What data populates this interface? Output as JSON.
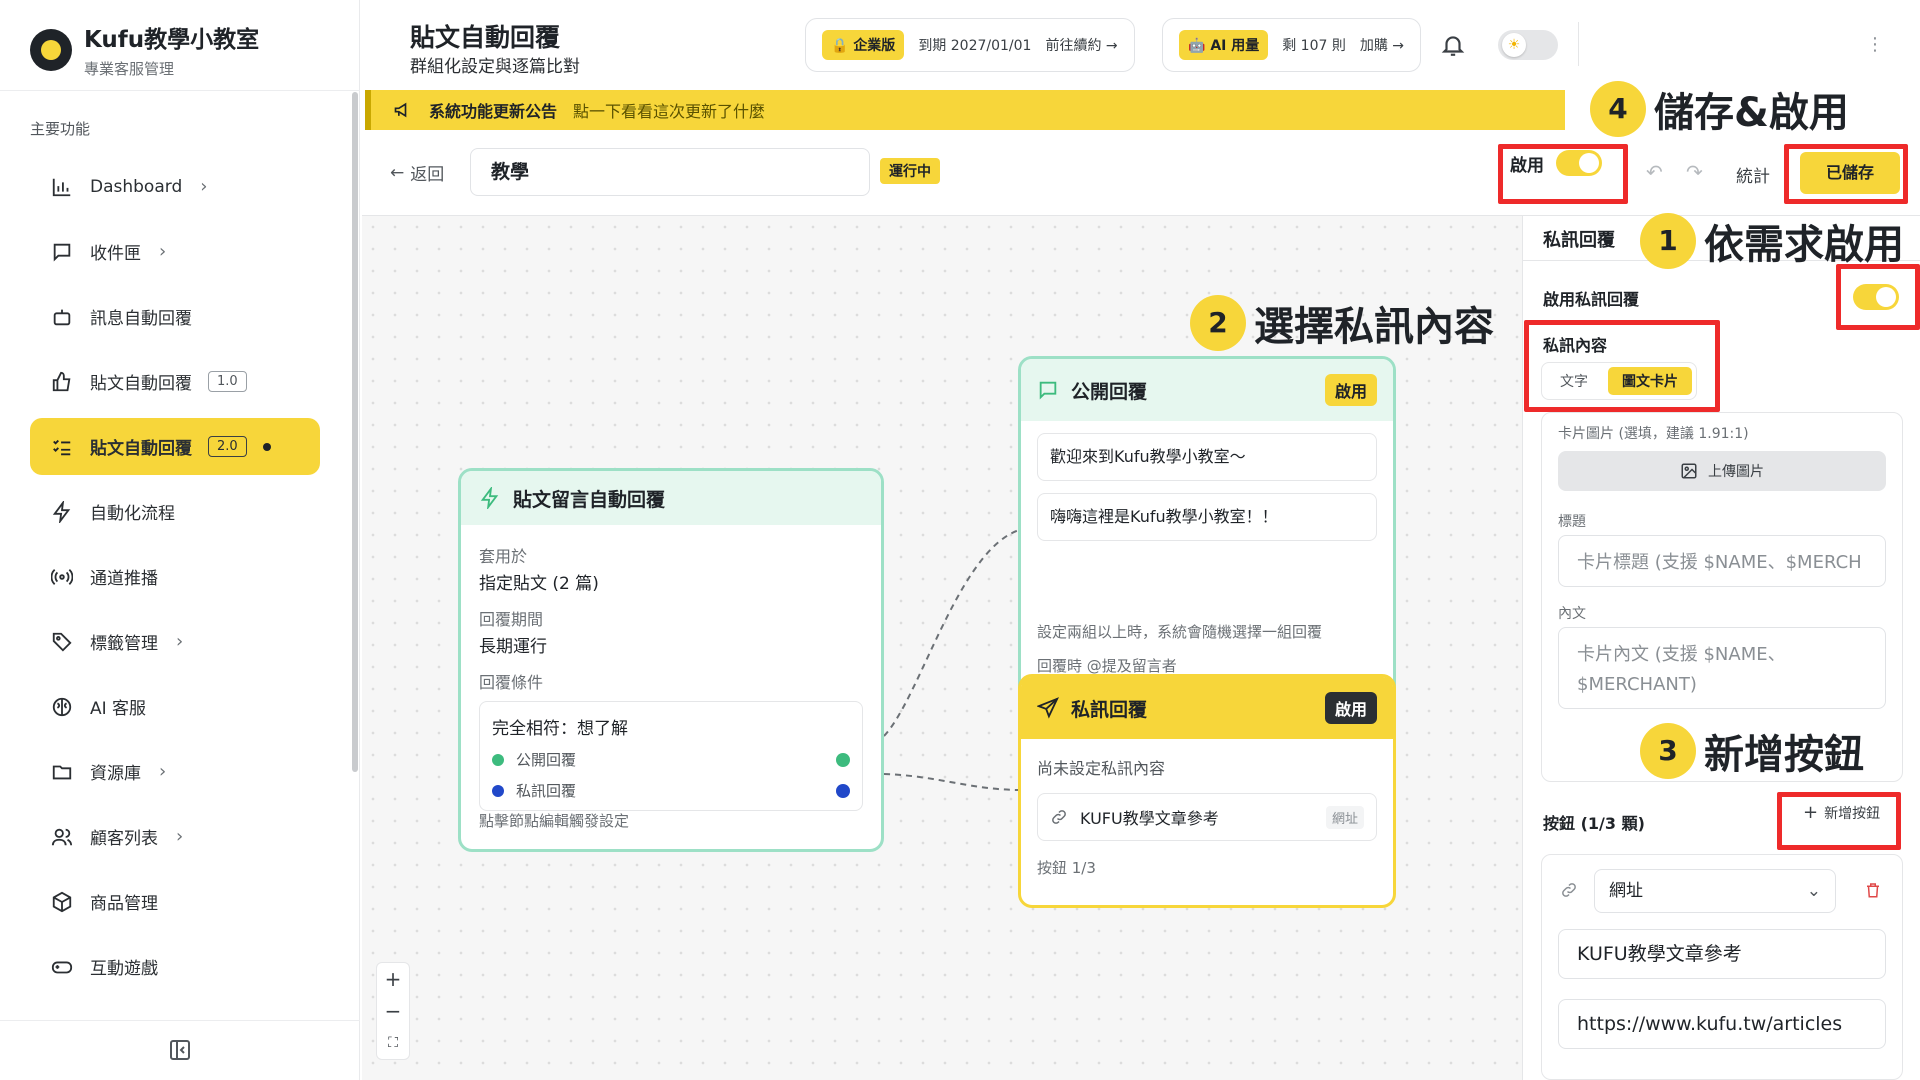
{
  "brand": {
    "title": "Kufu教學小教室",
    "subtitle": "專業客服管理"
  },
  "sidebar": {
    "section": "主要功能",
    "items": [
      {
        "label": "Dashboard",
        "icon": "bar-chart-icon",
        "chevron": "›"
      },
      {
        "label": "收件匣",
        "icon": "message-icon",
        "chevron": "›"
      },
      {
        "label": "訊息自動回覆",
        "icon": "bot-icon"
      },
      {
        "label": "貼文自動回覆",
        "icon": "thumbs-up-icon",
        "version": "1.0"
      },
      {
        "label": "貼文自動回覆",
        "icon": "list-check-icon",
        "version": "2.0",
        "active": true
      },
      {
        "label": "自動化流程",
        "icon": "lightning-icon"
      },
      {
        "label": "通道推播",
        "icon": "broadcast-icon"
      },
      {
        "label": "標籤管理",
        "icon": "tag-icon",
        "chevron": "›"
      },
      {
        "label": "AI 客服",
        "icon": "brain-icon"
      },
      {
        "label": "資源庫",
        "icon": "folder-icon",
        "chevron": "›"
      },
      {
        "label": "顧客列表",
        "icon": "users-icon",
        "chevron": "›"
      },
      {
        "label": "商品管理",
        "icon": "box-icon"
      },
      {
        "label": "互動遊戲",
        "icon": "gamepad-icon"
      }
    ]
  },
  "header": {
    "title": "貼文自動回覆",
    "subtitle": "群組化設定與逐篇比對",
    "plan": {
      "tag": "企業版",
      "expiry": "到期 2027/01/01",
      "action": "前往續約 →"
    },
    "ai": {
      "tag": "AI 用量",
      "remaining": "剩 107 則",
      "action": "加購 →"
    }
  },
  "announcement": {
    "title": "系統功能更新公告",
    "text": "點一下看看這次更新了什麼"
  },
  "toolbar": {
    "back": "返回",
    "name": "教學",
    "status": "運行中",
    "enable_label": "啟用",
    "stats": "統計",
    "save": "已儲存"
  },
  "canvas": {
    "trigger": {
      "title": "貼文留言自動回覆",
      "apply_label": "套用於",
      "apply_value": "指定貼文 (2 篇)",
      "period_label": "回覆期間",
      "period_value": "長期運行",
      "cond_label": "回覆條件",
      "cond_text": "完全相符：想了解",
      "out_public": "公開回覆",
      "out_private": "私訊回覆",
      "hint": "點擊節點編輯觸發設定"
    },
    "public_reply": {
      "title": "公開回覆",
      "badge": "啟用",
      "messages": [
        "歡迎來到Kufu教學小教室～",
        "嗨嗨這裡是Kufu教學小教室！！"
      ],
      "note": "設定兩組以上時，系統會隨機選擇一組回覆",
      "note2": "回覆時 @提及留言者"
    },
    "private_reply": {
      "title": "私訊回覆",
      "badge": "啟用",
      "empty": "尚未設定私訊內容",
      "button_label": "KUFU教學文章參考",
      "button_type": "網址",
      "count": "按鈕 1/3"
    },
    "zoom": [
      "+",
      "−",
      "⛶"
    ]
  },
  "panel": {
    "title": "私訊回覆",
    "toggle_label": "啟用私訊回覆",
    "content_label": "私訊內容",
    "content_options": [
      "文字",
      "圖文卡片"
    ],
    "card_image_label": "卡片圖片 (選填，建議 1.91:1)",
    "upload": "上傳圖片",
    "title_label": "標題",
    "title_placeholder": "卡片標題 (支援 $NAME、$MERCH",
    "body_label": "內文",
    "body_placeholder_1": "卡片內文 (支援 $NAME、",
    "body_placeholder_2": "$MERCHANT)",
    "buttons_label": "按鈕 (1/3 顆)",
    "add_button": "新增按鈕",
    "button": {
      "type": "網址",
      "label": "KUFU教學文章參考",
      "url": "https://www.kufu.tw/articles"
    }
  },
  "annotations": [
    {
      "num": "1",
      "text": "依需求啟用"
    },
    {
      "num": "2",
      "text": "選擇私訊內容"
    },
    {
      "num": "3",
      "text": "新增按鈕"
    },
    {
      "num": "4",
      "text": "儲存&啟用"
    }
  ],
  "colors": {
    "accent": "#f7d63a",
    "mint": "#9de0c6",
    "annotation_red": "#ee2a2a",
    "public_dot": "#3dbb7e",
    "private_dot": "#2148c9"
  }
}
